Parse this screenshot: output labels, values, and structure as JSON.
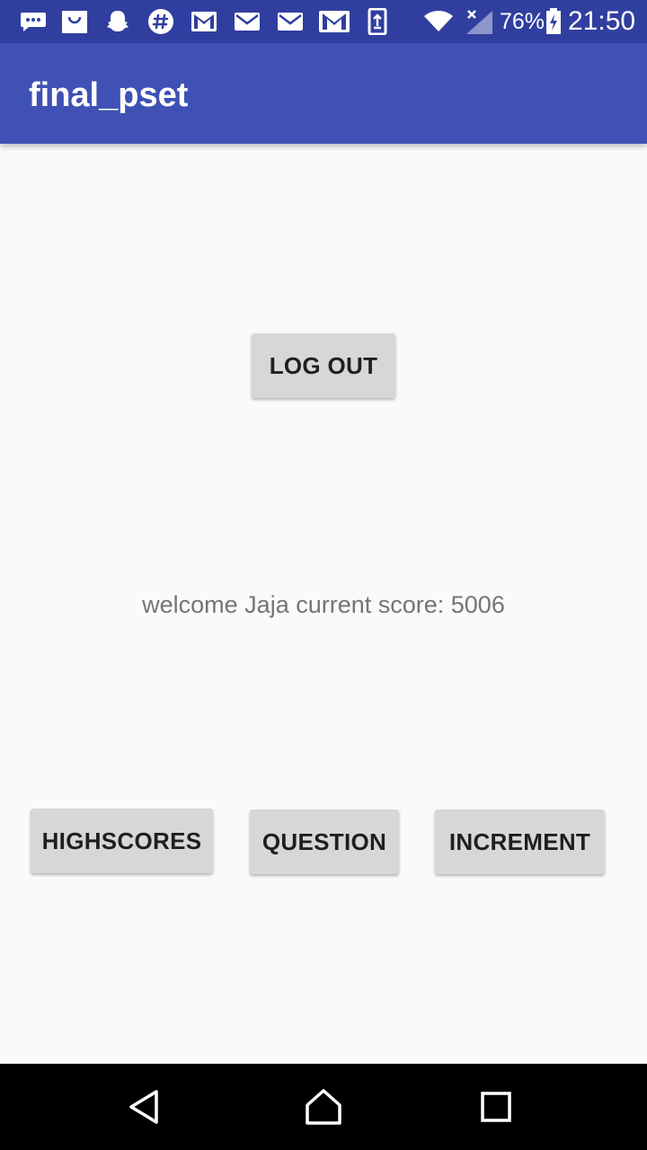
{
  "status_bar": {
    "notification_icons": [
      "messages-icon",
      "shopping-bag-icon",
      "snapchat-icon",
      "slack-icon",
      "gmail-icon",
      "email-icon",
      "email-icon",
      "gmail-icon",
      "phone-update-icon"
    ],
    "battery_percent": "76%",
    "time": "21:50"
  },
  "app_bar": {
    "title": "final_pset"
  },
  "main": {
    "logout_label": "LOG OUT",
    "welcome_text": "welcome Jaja current score: 5006",
    "highscores_label": "HIGHSCORES",
    "question_label": "QUESTION",
    "increment_label": "INCREMENT"
  },
  "nav_bar": {
    "icons": [
      "back-icon",
      "home-icon",
      "recents-icon"
    ]
  },
  "colors": {
    "status_bar": "#303f9f",
    "app_bar": "#3f51b5",
    "button": "#d6d7d7",
    "background": "#fafafa"
  }
}
